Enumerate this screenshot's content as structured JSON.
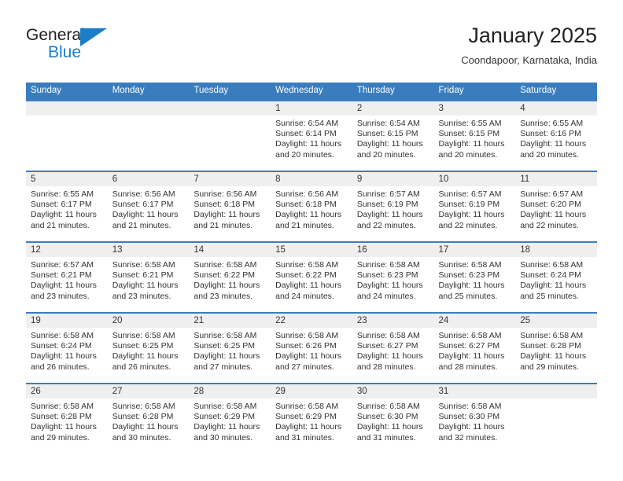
{
  "brand": {
    "name_primary": "General",
    "name_secondary": "Blue",
    "triangle_icon": "triangle-icon",
    "accent_color": "#1a7ec8"
  },
  "header": {
    "month_title": "January 2025",
    "location": "Coondapoor, Karnataka, India"
  },
  "theme": {
    "header_bar_color": "#3a7dbf",
    "date_band_color": "#efefef",
    "text_color": "#333333"
  },
  "weekday_headers": [
    "Sunday",
    "Monday",
    "Tuesday",
    "Wednesday",
    "Thursday",
    "Friday",
    "Saturday"
  ],
  "weeks": [
    [
      {
        "date": "",
        "sunrise": "",
        "sunset": "",
        "daylight_line1": "",
        "daylight_line2": "",
        "empty": true
      },
      {
        "date": "",
        "sunrise": "",
        "sunset": "",
        "daylight_line1": "",
        "daylight_line2": "",
        "empty": true
      },
      {
        "date": "",
        "sunrise": "",
        "sunset": "",
        "daylight_line1": "",
        "daylight_line2": "",
        "empty": true
      },
      {
        "date": "1",
        "sunrise": "Sunrise: 6:54 AM",
        "sunset": "Sunset: 6:14 PM",
        "daylight_line1": "Daylight: 11 hours",
        "daylight_line2": "and 20 minutes.",
        "empty": false
      },
      {
        "date": "2",
        "sunrise": "Sunrise: 6:54 AM",
        "sunset": "Sunset: 6:15 PM",
        "daylight_line1": "Daylight: 11 hours",
        "daylight_line2": "and 20 minutes.",
        "empty": false
      },
      {
        "date": "3",
        "sunrise": "Sunrise: 6:55 AM",
        "sunset": "Sunset: 6:15 PM",
        "daylight_line1": "Daylight: 11 hours",
        "daylight_line2": "and 20 minutes.",
        "empty": false
      },
      {
        "date": "4",
        "sunrise": "Sunrise: 6:55 AM",
        "sunset": "Sunset: 6:16 PM",
        "daylight_line1": "Daylight: 11 hours",
        "daylight_line2": "and 20 minutes.",
        "empty": false
      }
    ],
    [
      {
        "date": "5",
        "sunrise": "Sunrise: 6:55 AM",
        "sunset": "Sunset: 6:17 PM",
        "daylight_line1": "Daylight: 11 hours",
        "daylight_line2": "and 21 minutes.",
        "empty": false
      },
      {
        "date": "6",
        "sunrise": "Sunrise: 6:56 AM",
        "sunset": "Sunset: 6:17 PM",
        "daylight_line1": "Daylight: 11 hours",
        "daylight_line2": "and 21 minutes.",
        "empty": false
      },
      {
        "date": "7",
        "sunrise": "Sunrise: 6:56 AM",
        "sunset": "Sunset: 6:18 PM",
        "daylight_line1": "Daylight: 11 hours",
        "daylight_line2": "and 21 minutes.",
        "empty": false
      },
      {
        "date": "8",
        "sunrise": "Sunrise: 6:56 AM",
        "sunset": "Sunset: 6:18 PM",
        "daylight_line1": "Daylight: 11 hours",
        "daylight_line2": "and 21 minutes.",
        "empty": false
      },
      {
        "date": "9",
        "sunrise": "Sunrise: 6:57 AM",
        "sunset": "Sunset: 6:19 PM",
        "daylight_line1": "Daylight: 11 hours",
        "daylight_line2": "and 22 minutes.",
        "empty": false
      },
      {
        "date": "10",
        "sunrise": "Sunrise: 6:57 AM",
        "sunset": "Sunset: 6:19 PM",
        "daylight_line1": "Daylight: 11 hours",
        "daylight_line2": "and 22 minutes.",
        "empty": false
      },
      {
        "date": "11",
        "sunrise": "Sunrise: 6:57 AM",
        "sunset": "Sunset: 6:20 PM",
        "daylight_line1": "Daylight: 11 hours",
        "daylight_line2": "and 22 minutes.",
        "empty": false
      }
    ],
    [
      {
        "date": "12",
        "sunrise": "Sunrise: 6:57 AM",
        "sunset": "Sunset: 6:21 PM",
        "daylight_line1": "Daylight: 11 hours",
        "daylight_line2": "and 23 minutes.",
        "empty": false
      },
      {
        "date": "13",
        "sunrise": "Sunrise: 6:58 AM",
        "sunset": "Sunset: 6:21 PM",
        "daylight_line1": "Daylight: 11 hours",
        "daylight_line2": "and 23 minutes.",
        "empty": false
      },
      {
        "date": "14",
        "sunrise": "Sunrise: 6:58 AM",
        "sunset": "Sunset: 6:22 PM",
        "daylight_line1": "Daylight: 11 hours",
        "daylight_line2": "and 23 minutes.",
        "empty": false
      },
      {
        "date": "15",
        "sunrise": "Sunrise: 6:58 AM",
        "sunset": "Sunset: 6:22 PM",
        "daylight_line1": "Daylight: 11 hours",
        "daylight_line2": "and 24 minutes.",
        "empty": false
      },
      {
        "date": "16",
        "sunrise": "Sunrise: 6:58 AM",
        "sunset": "Sunset: 6:23 PM",
        "daylight_line1": "Daylight: 11 hours",
        "daylight_line2": "and 24 minutes.",
        "empty": false
      },
      {
        "date": "17",
        "sunrise": "Sunrise: 6:58 AM",
        "sunset": "Sunset: 6:23 PM",
        "daylight_line1": "Daylight: 11 hours",
        "daylight_line2": "and 25 minutes.",
        "empty": false
      },
      {
        "date": "18",
        "sunrise": "Sunrise: 6:58 AM",
        "sunset": "Sunset: 6:24 PM",
        "daylight_line1": "Daylight: 11 hours",
        "daylight_line2": "and 25 minutes.",
        "empty": false
      }
    ],
    [
      {
        "date": "19",
        "sunrise": "Sunrise: 6:58 AM",
        "sunset": "Sunset: 6:24 PM",
        "daylight_line1": "Daylight: 11 hours",
        "daylight_line2": "and 26 minutes.",
        "empty": false
      },
      {
        "date": "20",
        "sunrise": "Sunrise: 6:58 AM",
        "sunset": "Sunset: 6:25 PM",
        "daylight_line1": "Daylight: 11 hours",
        "daylight_line2": "and 26 minutes.",
        "empty": false
      },
      {
        "date": "21",
        "sunrise": "Sunrise: 6:58 AM",
        "sunset": "Sunset: 6:25 PM",
        "daylight_line1": "Daylight: 11 hours",
        "daylight_line2": "and 27 minutes.",
        "empty": false
      },
      {
        "date": "22",
        "sunrise": "Sunrise: 6:58 AM",
        "sunset": "Sunset: 6:26 PM",
        "daylight_line1": "Daylight: 11 hours",
        "daylight_line2": "and 27 minutes.",
        "empty": false
      },
      {
        "date": "23",
        "sunrise": "Sunrise: 6:58 AM",
        "sunset": "Sunset: 6:27 PM",
        "daylight_line1": "Daylight: 11 hours",
        "daylight_line2": "and 28 minutes.",
        "empty": false
      },
      {
        "date": "24",
        "sunrise": "Sunrise: 6:58 AM",
        "sunset": "Sunset: 6:27 PM",
        "daylight_line1": "Daylight: 11 hours",
        "daylight_line2": "and 28 minutes.",
        "empty": false
      },
      {
        "date": "25",
        "sunrise": "Sunrise: 6:58 AM",
        "sunset": "Sunset: 6:28 PM",
        "daylight_line1": "Daylight: 11 hours",
        "daylight_line2": "and 29 minutes.",
        "empty": false
      }
    ],
    [
      {
        "date": "26",
        "sunrise": "Sunrise: 6:58 AM",
        "sunset": "Sunset: 6:28 PM",
        "daylight_line1": "Daylight: 11 hours",
        "daylight_line2": "and 29 minutes.",
        "empty": false
      },
      {
        "date": "27",
        "sunrise": "Sunrise: 6:58 AM",
        "sunset": "Sunset: 6:28 PM",
        "daylight_line1": "Daylight: 11 hours",
        "daylight_line2": "and 30 minutes.",
        "empty": false
      },
      {
        "date": "28",
        "sunrise": "Sunrise: 6:58 AM",
        "sunset": "Sunset: 6:29 PM",
        "daylight_line1": "Daylight: 11 hours",
        "daylight_line2": "and 30 minutes.",
        "empty": false
      },
      {
        "date": "29",
        "sunrise": "Sunrise: 6:58 AM",
        "sunset": "Sunset: 6:29 PM",
        "daylight_line1": "Daylight: 11 hours",
        "daylight_line2": "and 31 minutes.",
        "empty": false
      },
      {
        "date": "30",
        "sunrise": "Sunrise: 6:58 AM",
        "sunset": "Sunset: 6:30 PM",
        "daylight_line1": "Daylight: 11 hours",
        "daylight_line2": "and 31 minutes.",
        "empty": false
      },
      {
        "date": "31",
        "sunrise": "Sunrise: 6:58 AM",
        "sunset": "Sunset: 6:30 PM",
        "daylight_line1": "Daylight: 11 hours",
        "daylight_line2": "and 32 minutes.",
        "empty": false
      },
      {
        "date": "",
        "sunrise": "",
        "sunset": "",
        "daylight_line1": "",
        "daylight_line2": "",
        "empty": true
      }
    ]
  ]
}
